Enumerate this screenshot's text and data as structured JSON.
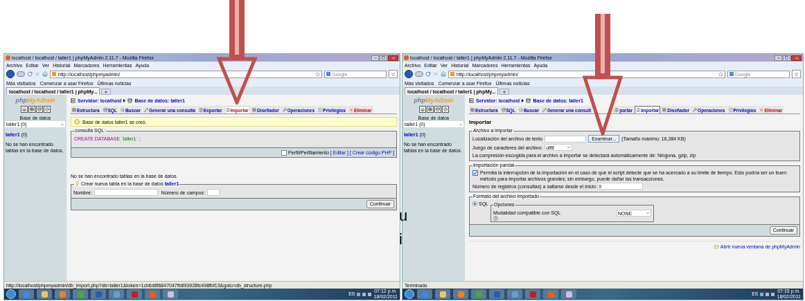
{
  "document": {
    "fragments": [
      "u",
      "i"
    ]
  },
  "windows": [
    {
      "title": "localhost / localhost / taller1 | phpMyAdmin 2.11.7 - Mozilla Firefox",
      "menu": [
        "Archivo",
        "Editar",
        "Ver",
        "Historial",
        "Marcadores",
        "Herramientas",
        "Ayuda"
      ],
      "url": "http://localhost/phpmyadmin/",
      "search_placeholder": "Google",
      "bookmarks": [
        "Más visitados",
        "Comenzar a usar Firefox",
        "Últimas noticias"
      ],
      "tab_title": "localhost / localhost / taller1 | phpMy...",
      "sidebar": {
        "logo_prefix": "php",
        "logo_suffix": "MyAdmin",
        "db_label": "Base de datos",
        "db_select": "taller1 (0)",
        "db_link": "taller1",
        "db_count": "(0)",
        "note": "No se han encontrado tablas en la base de datos."
      },
      "breadcrumb": {
        "server": "Servidor: localhost",
        "database": "Base de datos: taller1"
      },
      "tabs": [
        {
          "label": "Estructura",
          "kind": "normal",
          "selected": false,
          "highlighted": false
        },
        {
          "label": "SQL",
          "kind": "normal",
          "selected": false,
          "highlighted": false
        },
        {
          "label": "Buscar",
          "kind": "normal",
          "selected": false,
          "highlighted": false
        },
        {
          "label": "Generar una consulta",
          "kind": "normal",
          "selected": false,
          "highlighted": false
        },
        {
          "label": "Exportar",
          "kind": "normal",
          "selected": false,
          "highlighted": false
        },
        {
          "label": "Importar",
          "kind": "normal",
          "selected": false,
          "highlighted": true
        },
        {
          "label": "Diseñador",
          "kind": "normal",
          "selected": false,
          "highlighted": false
        },
        {
          "label": "Operaciones",
          "kind": "normal",
          "selected": false,
          "highlighted": false
        },
        {
          "label": "Privilegios",
          "kind": "normal",
          "selected": false,
          "highlighted": false
        },
        {
          "label": "Eliminar",
          "kind": "danger",
          "selected": false,
          "highlighted": false
        }
      ],
      "content": {
        "kind": "created",
        "notice": "Base de datos taller1 se creó.",
        "sql_legend": "consulta SQL:",
        "query_keyword": "CREATE DATABASE",
        "query_name": "`taller1`",
        "query_end": ";",
        "profiling": {
          "label": "Perfil/Perfilamiento",
          "checked": false
        },
        "links": [
          "[ Editar ]",
          "[ Crear código PHP ]"
        ],
        "no_tables": "No se han encontrado tablas en la base de datos.",
        "create_legend": "Crear nueva tabla en la base de datos",
        "create_db": "taller1",
        "name_label": "Nombre:",
        "fields_label": "Número de campos:",
        "button": "Continuar"
      },
      "status": "http://localhost/phpmyadmin/db_import.php?db=taller1&token=1cb6d8f6847047fb893928fc498fbf13&goto=db_structure.php",
      "taskbar": {
        "language": "ES",
        "time": "07:12 p.m.",
        "date": "18/02/2011"
      }
    },
    {
      "title": "localhost / localhost / taller1 | phpMyAdmin 2.11.7 - Mozilla Firefox",
      "menu": [
        "Archivo",
        "Editar",
        "Ver",
        "Historial",
        "Marcadores",
        "Herramientas",
        "Ayuda"
      ],
      "url": "http://localhost/phpmyadmin/",
      "search_placeholder": "Google",
      "bookmarks": [
        "Más visitados",
        "Comenzar a usar Firefox",
        "Últimas noticias"
      ],
      "tab_title": "localhost / localhost / taller1 | phpMy...",
      "sidebar": {
        "logo_prefix": "php",
        "logo_suffix": "MyAdmin",
        "db_label": "Base de datos",
        "db_select": "taller1 (0)",
        "db_link": "taller1",
        "db_count": "(0)",
        "note": "No se han encontrado tablas en la base de datos."
      },
      "breadcrumb": {
        "server": "Servidor: localhost",
        "database": "Base de datos: taller1"
      },
      "tabs": [
        {
          "label": "Estructura",
          "kind": "normal",
          "selected": false,
          "highlighted": false
        },
        {
          "label": "SQL",
          "kind": "normal",
          "selected": false,
          "highlighted": false
        },
        {
          "label": "Buscar",
          "kind": "normal",
          "selected": false,
          "highlighted": false
        },
        {
          "label": "Generar una consult",
          "kind": "normal",
          "selected": false,
          "highlighted": false
        },
        {
          "label": "portar",
          "kind": "normal",
          "selected": false,
          "highlighted": false
        },
        {
          "label": "Importar",
          "kind": "normal",
          "selected": true,
          "highlighted": false
        },
        {
          "label": "Diseñador",
          "kind": "normal",
          "selected": false,
          "highlighted": false
        },
        {
          "label": "Operaciones",
          "kind": "normal",
          "selected": false,
          "highlighted": false
        },
        {
          "label": "Privilegios",
          "kind": "normal",
          "selected": false,
          "highlighted": false
        },
        {
          "label": "Eliminar",
          "kind": "danger",
          "selected": false,
          "highlighted": false
        }
      ],
      "content": {
        "kind": "import",
        "heading": "Importar",
        "file_legend": "Archivo a importar",
        "file_label": "Localización del archivo de texto",
        "browse_button": "Examinar...",
        "max_size": "(Tamaño máximo: 16,384 KB)",
        "charset_label": "Juego de caracteres del archivo:",
        "charset": "utf8",
        "compression_note": "La compresión escogida para el archivo a importar se detectará automáticamente de: Ninguna, gzip, zip",
        "partial_legend": "Importación parcial",
        "interrupt": {
          "label": "Permita la interrupción de la importación en el caso de que el script detecte que se ha acercado a su límite de tiempo. Esto podría ser un buen método para importar archivos grandes; sin embargo, puede dañar las transacciones.",
          "checked": true
        },
        "skip_label": "Número de registros (consultas) a saltarse desde el inicio",
        "skip_value": "0",
        "format_legend": "Formato del archivo importado",
        "format": {
          "label": "SQL",
          "selected": true
        },
        "options_legend": "Opciones",
        "compat_label": "Modalidad compatible con SQL",
        "compat_value": "NONE",
        "button": "Continuar",
        "new_window_link": "Abrir nueva ventana de phpMyAdmin"
      },
      "status": "Terminado",
      "taskbar": {
        "language": "ES",
        "time": "07:15 p.m.",
        "date": "18/02/2011"
      }
    }
  ]
}
